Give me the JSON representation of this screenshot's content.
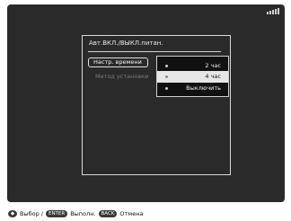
{
  "dialog": {
    "title": "Авт.ВКЛ./ВЫКЛ.питан.",
    "items": [
      {
        "label": "Настр. времени",
        "state": "selected"
      },
      {
        "label": "Метод установки",
        "state": "disabled"
      }
    ]
  },
  "submenu": {
    "options": [
      {
        "label": "2 час",
        "active": false
      },
      {
        "label": "4 час",
        "active": true
      },
      {
        "label": "Выключить",
        "active": false
      }
    ]
  },
  "footer": {
    "select_label": "Выбор /",
    "enter_key": "ENTER",
    "enter_label": "Выполн.",
    "back_key": "BACK",
    "back_label": "Отмена",
    "nav_key": "◆"
  },
  "status": {
    "battery_icon": "battery-icon"
  }
}
